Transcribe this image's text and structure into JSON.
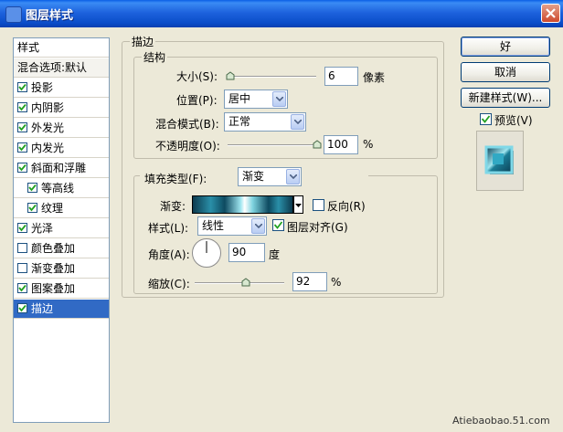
{
  "window": {
    "title": "图层样式"
  },
  "sidebar": {
    "header": "样式",
    "blend": "混合选项:默认",
    "items": [
      {
        "label": "投影",
        "checked": true
      },
      {
        "label": "内阴影",
        "checked": true
      },
      {
        "label": "外发光",
        "checked": true
      },
      {
        "label": "内发光",
        "checked": true
      },
      {
        "label": "斜面和浮雕",
        "checked": true
      },
      {
        "label": "等高线",
        "checked": true
      },
      {
        "label": "纹理",
        "checked": true
      },
      {
        "label": "光泽",
        "checked": true
      },
      {
        "label": "颜色叠加",
        "checked": false
      },
      {
        "label": "渐变叠加",
        "checked": false
      },
      {
        "label": "图案叠加",
        "checked": true
      },
      {
        "label": "描边",
        "checked": true,
        "active": true
      }
    ]
  },
  "stroke": {
    "title": "描边",
    "structure": {
      "title": "结构",
      "size_label": "大小(S):",
      "size_value": "6",
      "size_unit": "像素",
      "position_label": "位置(P):",
      "position_value": "居中",
      "blend_label": "混合模式(B):",
      "blend_value": "正常",
      "opacity_label": "不透明度(O):",
      "opacity_value": "100",
      "opacity_unit": "%"
    },
    "fill": {
      "type_label": "填充类型(F):",
      "type_value": "渐变",
      "gradient_label": "渐变:",
      "reverse_label": "反向(R)",
      "reverse_checked": false,
      "style_label": "样式(L):",
      "style_value": "线性",
      "align_label": "图层对齐(G)",
      "align_checked": true,
      "angle_label": "角度(A):",
      "angle_value": "90",
      "angle_unit": "度",
      "scale_label": "缩放(C):",
      "scale_value": "92",
      "scale_unit": "%"
    }
  },
  "buttons": {
    "ok": "好",
    "cancel": "取消",
    "new_style": "新建样式(W)...",
    "preview_label": "预览(V)",
    "preview_checked": true
  },
  "watermark": "Atiebaobao.51.com",
  "colors": {
    "title_bar": "#0a4cc8",
    "selection": "#316ac5",
    "dialog_bg": "#ece9d8"
  }
}
